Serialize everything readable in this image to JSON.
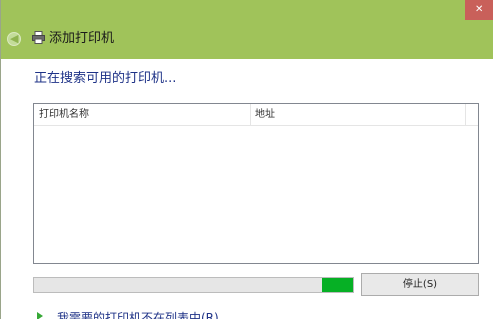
{
  "window": {
    "close_label": "✕"
  },
  "header": {
    "title": "添加打印机"
  },
  "main": {
    "status_text": "正在搜索可用的打印机...",
    "list": {
      "columns": [
        "打印机名称",
        "地址"
      ],
      "rows": []
    },
    "progress": {
      "fill_fraction": 0.1,
      "color": "#06b025"
    },
    "stop_button_label": "停止(S)",
    "bottom_link": "我需要的打印机不在列表中(R)"
  },
  "colors": {
    "titlebar": "#a0c35a",
    "close_button": "#c9605a",
    "link_text": "#1e3287"
  }
}
